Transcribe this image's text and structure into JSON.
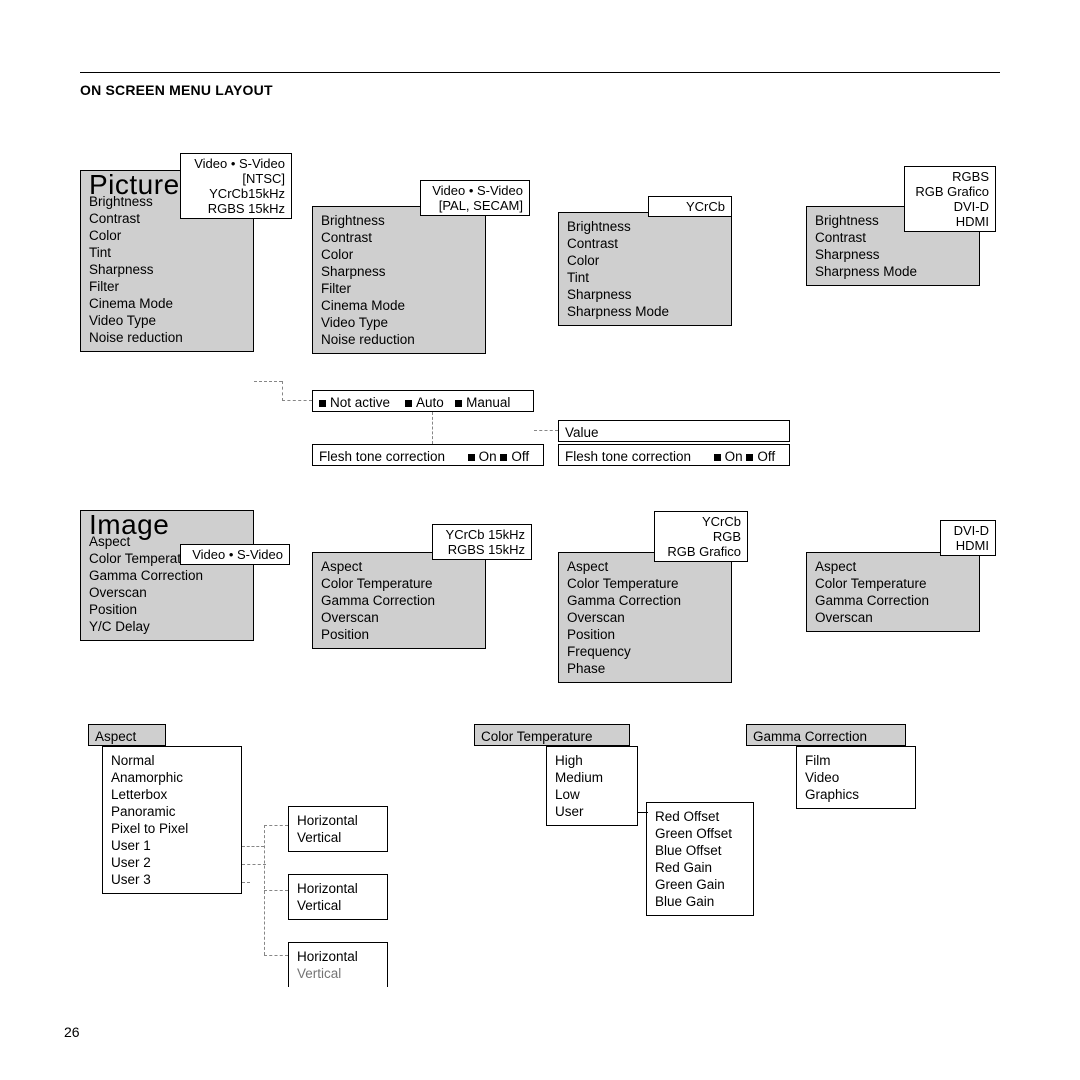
{
  "header": "ON SCREEN MENU LAYOUT",
  "page_number": "26",
  "picture": {
    "title": "Picture",
    "col1_tag": [
      "Video • S-Video",
      "[NTSC]",
      "YCrCb15kHz",
      "RGBS 15kHz"
    ],
    "col1_items": [
      "Brightness",
      "Contrast",
      "Color",
      "Tint",
      "Sharpness",
      "Filter",
      "Cinema Mode",
      "Video Type",
      "Noise reduction"
    ],
    "col2_tag": [
      "Video • S-Video",
      "[PAL, SECAM]"
    ],
    "col2_items": [
      "Brightness",
      "Contrast",
      "Color",
      "Sharpness",
      "Filter",
      "Cinema Mode",
      "Video Type",
      "Noise reduction"
    ],
    "col3_tag": [
      "YCrCb"
    ],
    "col3_items": [
      "Brightness",
      "Contrast",
      "Color",
      "Tint",
      "Sharpness",
      "Sharpness Mode"
    ],
    "col4_tag": [
      "RGBS",
      "RGB Grafico",
      "DVI-D",
      "HDMI"
    ],
    "col4_items": [
      "Brightness",
      "Contrast",
      "Sharpness",
      "Sharpness Mode"
    ],
    "nr_options": {
      "a": "Not active",
      "b": "Auto",
      "c": "Manual"
    },
    "value_label": "Value",
    "flesh_label": "Flesh tone correction",
    "on": "On",
    "off": "Off"
  },
  "image": {
    "title": "Image",
    "col1_tag": [
      "Video • S-Video"
    ],
    "col1_items": [
      "Aspect",
      "Color Temperature",
      "Gamma Correction",
      "Overscan",
      "Position",
      "Y/C  Delay"
    ],
    "col2_tag": [
      "YCrCb  15kHz",
      "RGBS  15kHz"
    ],
    "col2_items": [
      "Aspect",
      "Color Temperature",
      "Gamma Correction",
      "Overscan",
      "Position"
    ],
    "col3_tag": [
      "YCrCb",
      "RGB",
      "RGB  Grafico"
    ],
    "col3_items": [
      "Aspect",
      "Color Temperature",
      "Gamma Correction",
      "Overscan",
      "Position",
      "Frequency",
      "Phase"
    ],
    "col4_tag": [
      "DVI-D",
      "HDMI"
    ],
    "col4_items": [
      "Aspect",
      "Color Temperature",
      "Gamma Correction",
      "Overscan"
    ],
    "aspect": {
      "title": "Aspect",
      "items": [
        "Normal",
        "Anamorphic",
        "Letterbox",
        "Panoramic",
        "Pixel to Pixel",
        "User 1",
        "User 2",
        "User 3"
      ]
    },
    "hv": {
      "h": "Horizontal",
      "v": "Vertical"
    },
    "ct": {
      "title": "Color Temperature",
      "items": [
        "High",
        "Medium",
        "Low",
        "User"
      ],
      "user": [
        "Red Offset",
        "Green Offset",
        "Blue Offset",
        "Red Gain",
        "Green Gain",
        "Blue Gain"
      ]
    },
    "gc": {
      "title": "Gamma Correction",
      "items": [
        "Film",
        "Video",
        "Graphics"
      ]
    }
  }
}
